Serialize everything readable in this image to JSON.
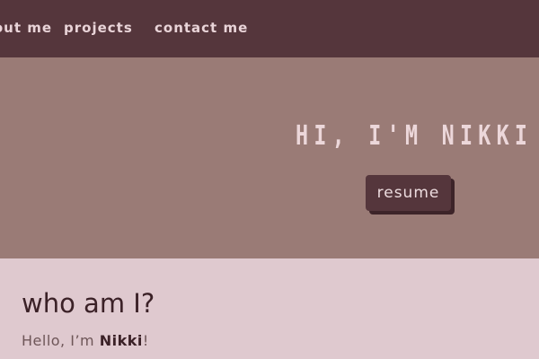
{
  "nav": {
    "items": [
      "about me",
      "projects",
      "contact me"
    ]
  },
  "hero": {
    "title": "HI, I'M NIKKI",
    "resume_label": "resume"
  },
  "about": {
    "heading": "who am I?",
    "intro_prefix": "Hello, I’m ",
    "intro_name": "Nikki",
    "intro_suffix": "!"
  },
  "colors": {
    "navbar": "#55363c",
    "hero_background": "#9a7b76",
    "page_background": "#dfc9cf",
    "button": "#55363c",
    "text_light": "#ecd7da",
    "text_dark": "#3b2127"
  }
}
